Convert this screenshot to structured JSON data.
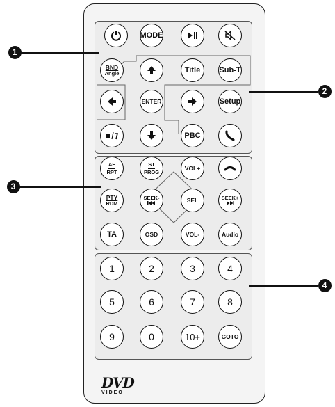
{
  "remote": {
    "row1": {
      "mode": "MODE"
    },
    "bnd": {
      "top": "BND",
      "bottom": "Angle"
    },
    "nav": {
      "enter": "ENTER",
      "title": "Title",
      "subt": "Sub-T",
      "setup": "Setup",
      "pbc": "PBC"
    },
    "row3": {
      "af": "AF",
      "rpt": "RPT",
      "st": "ST",
      "prog": "PROG",
      "volup": "VOL+",
      "pty": "PTY",
      "rdm": "RDM",
      "seek_minus": "SEEK-",
      "sel": "SEL",
      "seek_plus": "SEEK+",
      "ta": "TA",
      "osd": "OSD",
      "voldown": "VOL-",
      "audio": "Audio"
    },
    "numbers": [
      "1",
      "2",
      "3",
      "4",
      "5",
      "6",
      "7",
      "8",
      "9",
      "0",
      "10+",
      "GOTO"
    ],
    "logo": {
      "main": "DVD",
      "sub": "VIDEO"
    }
  },
  "callouts": [
    "1",
    "2",
    "3",
    "4"
  ],
  "icons": {
    "power": "power-icon",
    "play_pause": "play-pause-icon",
    "mute": "mute-icon",
    "up": "arrow-up-icon",
    "down": "arrow-down-icon",
    "left": "arrow-left-icon",
    "right": "arrow-right-icon",
    "stop_return": "stop-return-icon",
    "call": "call-answer-icon",
    "hangup": "call-hangup-icon",
    "prev": "previous-icon",
    "next": "next-icon"
  }
}
